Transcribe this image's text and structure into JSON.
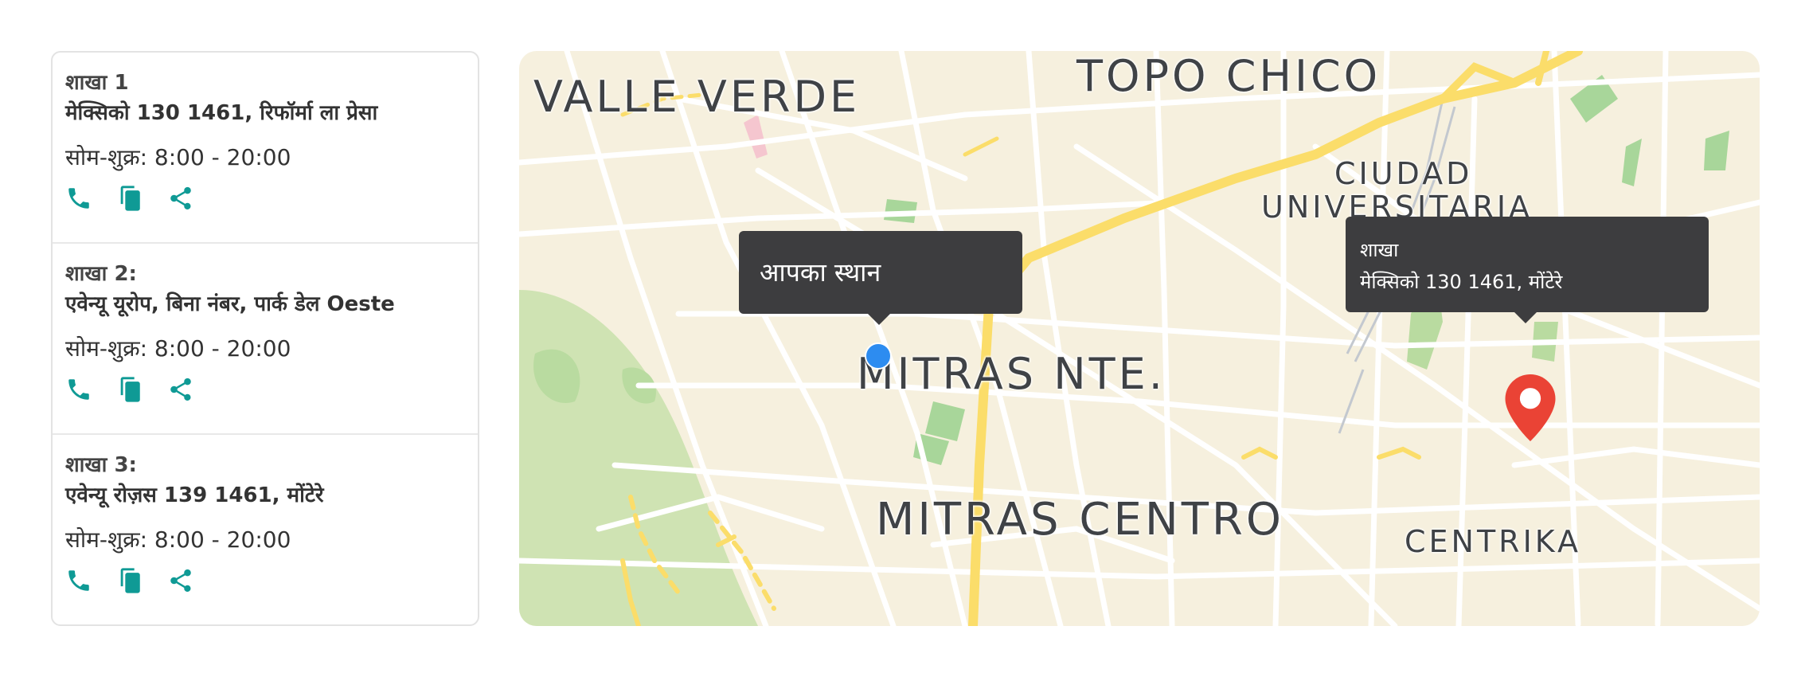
{
  "branches": [
    {
      "title": "शाखा 1",
      "address": "मेक्सिको 130 1461, रिफॉर्मा ला प्रेसा",
      "hours": "सोम-शुक्र: 8:00 - 20:00",
      "actions": [
        "phone-icon",
        "copy-icon",
        "share-icon"
      ]
    },
    {
      "title": "शाखा 2:",
      "address": "एवेन्यू यूरोप, बिना नंबर, पार्क डेल Oeste",
      "hours": "सोम-शुक्र: 8:00 - 20:00",
      "actions": [
        "phone-icon",
        "copy-icon",
        "share-icon"
      ]
    },
    {
      "title": "शाखा 3:",
      "address": "एवेन्यू रोज़स 139 1461, मोंटेरे",
      "hours": "सोम-शुक्र: 8:00 - 20:00",
      "actions": [
        "phone-icon",
        "copy-icon",
        "share-icon"
      ]
    }
  ],
  "map": {
    "labels": {
      "valle_verde": "VALLE VERDE",
      "topo_chico": "TOPO CHICO",
      "ciudad": "CIUDAD",
      "universitaria": "UNIVERSITARIA",
      "mitras_nte": "MITRAS NTE.",
      "mitras_centro": "MITRAS CENTRO",
      "centrika": "CENTRIKA"
    },
    "user_tooltip": "आपका स्थान",
    "branch_tooltip": {
      "title": "शाखा",
      "address": "मेक्सिको 130 1461, मोंटेरे"
    },
    "colors": {
      "land": "#f6f0de",
      "park": "#c9dfae",
      "major_road": "#fbdd6a",
      "rail": "#b8bec6",
      "accent": "#0f9a95",
      "user_dot": "#2d8cf0",
      "pin": "#ea4335"
    }
  }
}
